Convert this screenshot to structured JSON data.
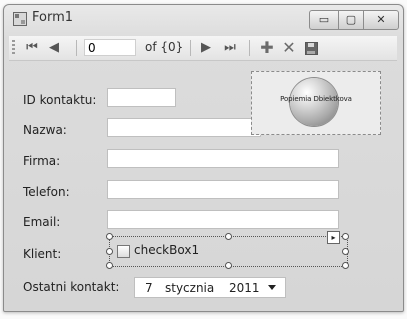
{
  "window": {
    "title": "Form1",
    "buttons": {
      "minimize": "▭",
      "maximize": "▢",
      "close": "✕"
    }
  },
  "toolbar": {
    "position_value": "0",
    "count_text": "of {0}",
    "icons": [
      "first-record-icon",
      "previous-record-icon",
      "next-record-icon",
      "last-record-icon",
      "add-icon",
      "delete-icon",
      "save-icon"
    ]
  },
  "form": {
    "id_label": "ID kontaktu:",
    "name_label": "Nazwa:",
    "company_label": "Firma:",
    "phone_label": "Telefon:",
    "email_label": "Email:",
    "client_label": "Klient:",
    "last_contact_label": "Ostatni kontakt:",
    "id_value": "",
    "name_value": "",
    "company_value": "",
    "phone_value": "",
    "email_value": ""
  },
  "picture": {
    "text": "Popiemia Dbiektkova"
  },
  "checkbox": {
    "label": "checkBox1",
    "checked": false
  },
  "date_picker": {
    "day": "7",
    "month": "stycznia",
    "year": "2011"
  }
}
